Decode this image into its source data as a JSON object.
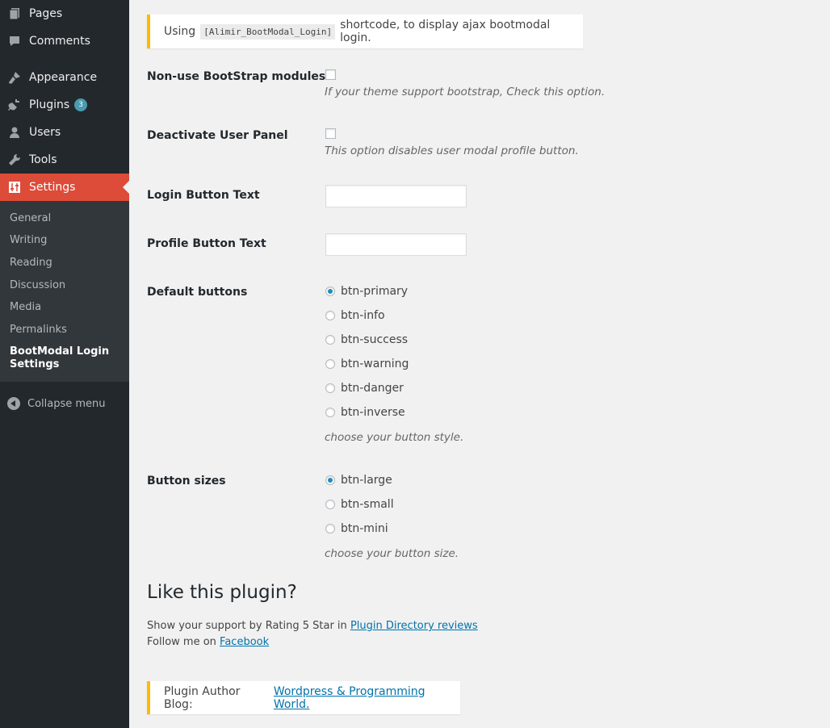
{
  "sidebar": {
    "menu": {
      "pages": "Pages",
      "comments": "Comments",
      "appearance": "Appearance",
      "plugins": "Plugins",
      "plugins_badge": "3",
      "users": "Users",
      "tools": "Tools",
      "settings": "Settings"
    },
    "submenu": {
      "general": "General",
      "writing": "Writing",
      "reading": "Reading",
      "discussion": "Discussion",
      "media": "Media",
      "permalinks": "Permalinks",
      "bootmodal": "BootModal Login Settings"
    },
    "collapse": "Collapse menu"
  },
  "notice_shortcode": {
    "before": "Using",
    "code": "[Alimir_BootModal_Login]",
    "after": "shortcode, to display ajax bootmodal login."
  },
  "fields": {
    "nonuse_bootstrap": {
      "label": "Non-use BootStrap modules",
      "description": "If your theme support bootstrap, Check this option.",
      "checked": false
    },
    "deactivate_panel": {
      "label": "Deactivate User Panel",
      "description": "This option disables user modal profile button.",
      "checked": false
    },
    "login_button_text": {
      "label": "Login Button Text",
      "value": ""
    },
    "profile_button_text": {
      "label": "Profile Button Text",
      "value": ""
    },
    "default_buttons": {
      "label": "Default buttons",
      "options": [
        "btn-primary",
        "btn-info",
        "btn-success",
        "btn-warning",
        "btn-danger",
        "btn-inverse"
      ],
      "selected": "btn-primary",
      "description": "choose your button style."
    },
    "button_sizes": {
      "label": "Button sizes",
      "options": [
        "btn-large",
        "btn-small",
        "btn-mini"
      ],
      "selected": "btn-large",
      "description": "choose your button size."
    }
  },
  "like": {
    "heading": "Like this plugin?",
    "support_text": "Show your support by Rating 5 Star in",
    "support_link": "Plugin Directory reviews",
    "follow_text": "Follow me on",
    "follow_link": "Facebook"
  },
  "notice_author": {
    "text": "Plugin Author Blog:",
    "link": "Wordpress & Programming World."
  },
  "colors": {
    "sidebar_bg": "#23282d",
    "submenu_bg": "#32373c",
    "current_menu": "#dd4b39",
    "notice_border": "#ffba00",
    "link": "#0073aa",
    "radio_dot": "#1e8cbe"
  }
}
